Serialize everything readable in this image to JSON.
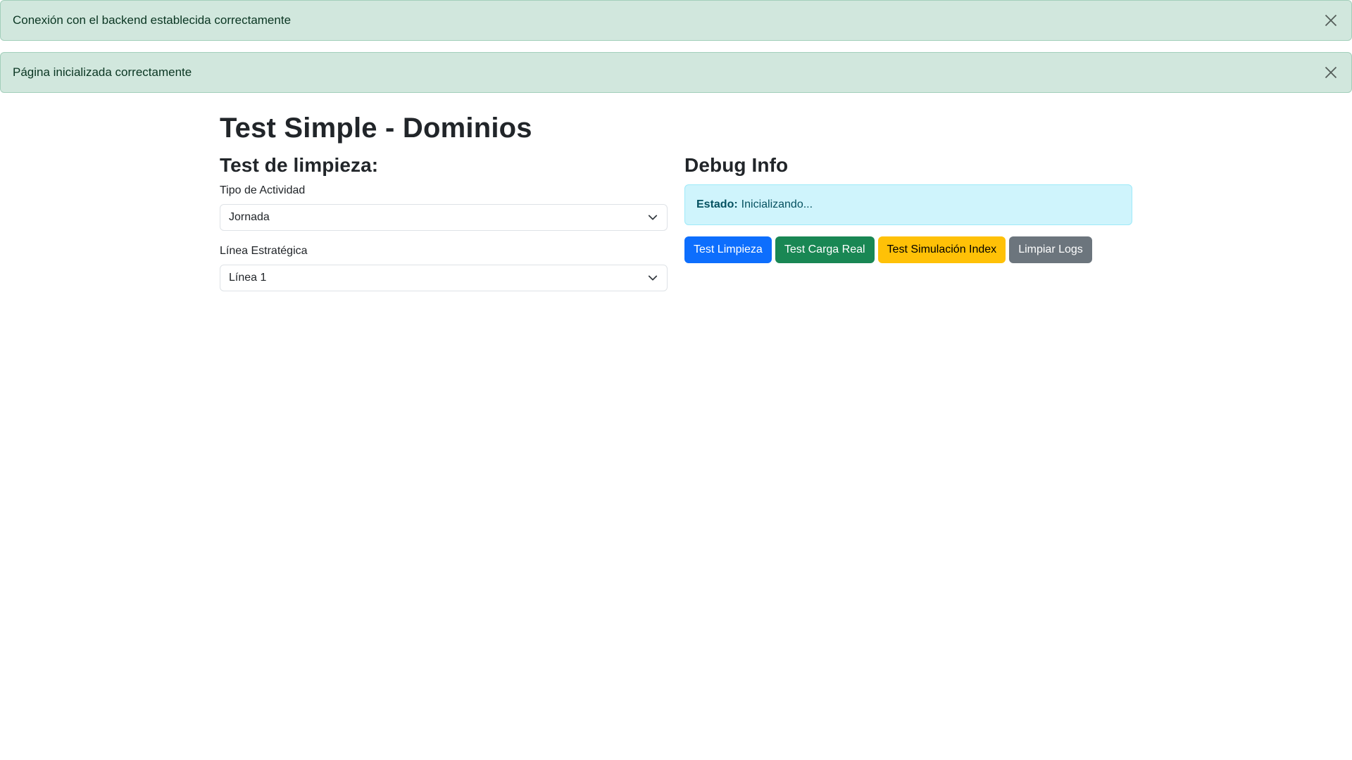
{
  "alerts": [
    {
      "message": "Conexión con el backend establecida correctamente",
      "close_icon": "close-icon"
    },
    {
      "message": "Página inicializada correctamente",
      "close_icon": "close-icon"
    }
  ],
  "page": {
    "title": "Test Simple - Dominios"
  },
  "left": {
    "section_title": "Test de limpieza:",
    "fields": [
      {
        "label": "Tipo de Actividad",
        "value": "Jornada"
      },
      {
        "label": "Línea Estratégica",
        "value": "Línea 1"
      }
    ]
  },
  "right": {
    "section_title": "Debug Info",
    "status_label": "Estado:",
    "status_value": "Inicializando...",
    "buttons": [
      {
        "label": "Test Limpieza",
        "color": "#0d6efd"
      },
      {
        "label": "Test Carga Real",
        "color": "#198754"
      },
      {
        "label": "Test Simulación Index",
        "color": "#ffc107"
      },
      {
        "label": "Limpiar Logs",
        "color": "#6c757d"
      }
    ]
  },
  "colors": {
    "alert_success_bg": "#d1e7dd",
    "alert_success_text": "#0a3622",
    "info_bg": "#cff4fc",
    "info_text": "#055160"
  }
}
